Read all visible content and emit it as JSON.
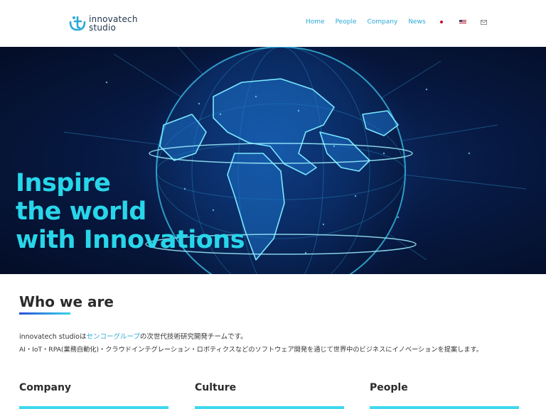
{
  "header": {
    "logo_line1": "innovatech",
    "logo_line2": "studio",
    "nav": [
      "Home",
      "People",
      "Company",
      "News"
    ],
    "icons": [
      "flag-japan-icon",
      "flag-us-icon",
      "mail-icon"
    ]
  },
  "hero": {
    "headline": [
      "Inspire",
      "the world",
      "with Innovations"
    ]
  },
  "about": {
    "title": "Who we are",
    "line1_pre": "innovatech studioは",
    "line1_link": "センコーグループ",
    "line1_post": "の次世代技術研究開発チームです。",
    "line2": "AI・IoT・RPA(業務自動化)・クラウドインテグレーション・ロボティクスなどのソフトウェア開発を通じて世界中のビジネスにイノベーションを提案します。"
  },
  "cards": [
    "Company",
    "Culture",
    "People"
  ],
  "colors": {
    "accent": "#28d6ea",
    "nav": "#2aa9d6",
    "hero_bg": "#071a44",
    "underline_start": "#2a4fd6",
    "underline_end": "#34d4ec"
  }
}
